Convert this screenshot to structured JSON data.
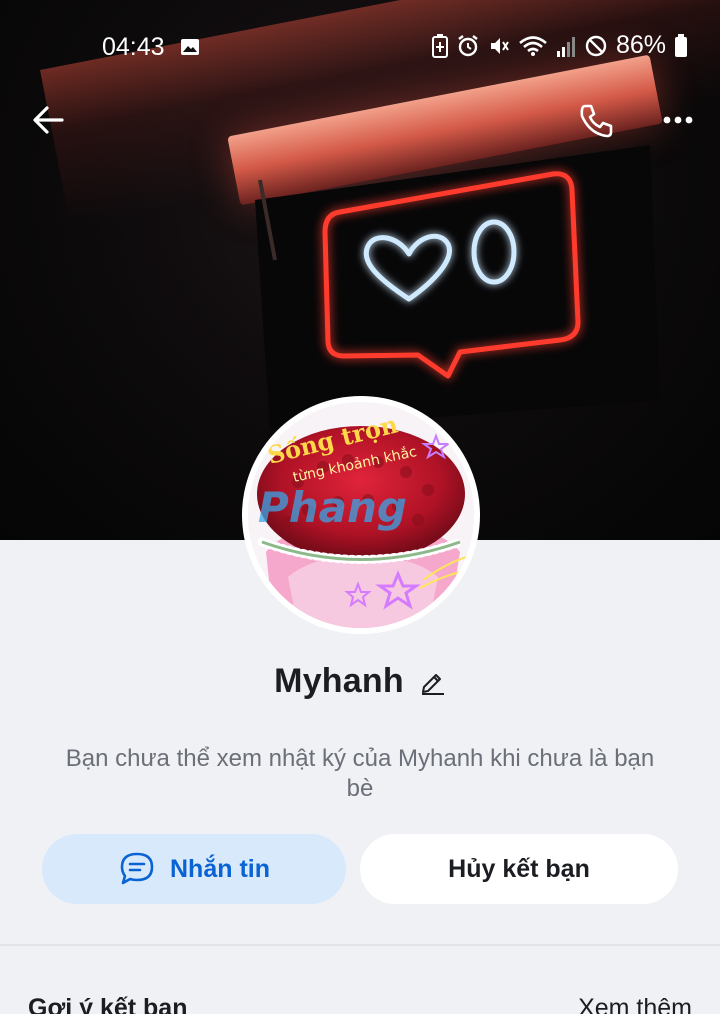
{
  "status_bar": {
    "time": "04:43",
    "battery": "86%",
    "icons": [
      "image-icon",
      "battery-saver-icon",
      "alarm-icon",
      "mute-icon",
      "wifi-icon",
      "signal-icon",
      "dnd-icon",
      "battery-icon"
    ]
  },
  "header": {
    "back_icon": "arrow-left-icon",
    "call_icon": "phone-icon",
    "more_icon": "more-dots-icon"
  },
  "profile": {
    "name": "Myhanh",
    "avatar_text_line1": "Sống trọn",
    "avatar_text_line2": "từng khoảnh khắc",
    "avatar_watermark": "Phang",
    "notice": "Bạn chưa thể xem nhật ký của Myhanh khi chưa là bạn bè"
  },
  "actions": {
    "message_label": "Nhắn tin",
    "unfriend_label": "Hủy kết bạn"
  },
  "suggestions": {
    "title": "Gợi ý kết bạn",
    "more_label": "Xem thêm"
  },
  "colors": {
    "accent": "#0a63d3",
    "accent_bg": "#d9e9fc",
    "page_bg": "#f0f1f5",
    "neon_red": "#ff3b2f",
    "neon_blue": "#bfe3ff"
  }
}
